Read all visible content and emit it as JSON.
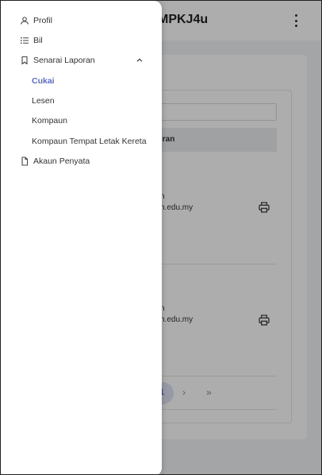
{
  "app": {
    "title": "MPKJ4u",
    "table_header_partial": "iran",
    "rows": [
      {
        "line1_partial": "n",
        "line2_partial": "n.edu.my"
      },
      {
        "line1_partial": "n",
        "line2_partial": "n.edu.my"
      }
    ],
    "pagination": {
      "current_page": "1",
      "next": "›",
      "last": "»"
    }
  },
  "drawer": {
    "items": [
      {
        "label": "Profil",
        "icon": "user-icon"
      },
      {
        "label": "Bil",
        "icon": "list-icon"
      },
      {
        "label": "Senarai Laporan",
        "icon": "bookmark-icon",
        "expanded": true,
        "children": [
          {
            "label": "Cukai",
            "active": true
          },
          {
            "label": "Lesen"
          },
          {
            "label": "Kompaun"
          },
          {
            "label": "Kompaun Tempat Letak Kereta"
          }
        ]
      },
      {
        "label": "Akaun Penyata",
        "icon": "file-icon"
      }
    ]
  },
  "colors": {
    "accent": "#5c6bc0",
    "overlay": "rgba(0,0,0,0.32)",
    "text": "#333333"
  }
}
